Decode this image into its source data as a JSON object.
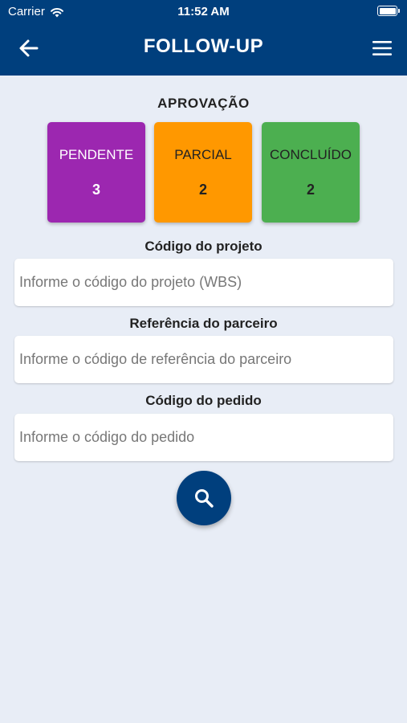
{
  "status_bar": {
    "carrier": "Carrier",
    "time": "11:52 AM"
  },
  "header": {
    "title": "FOLLOW-UP",
    "back_icon": "arrow-left-icon",
    "menu_icon": "hamburger-menu-icon"
  },
  "approval": {
    "title": "APROVAÇÃO",
    "cards": [
      {
        "label": "PENDENTE",
        "count": "3",
        "color": "#9c27b0",
        "text_color": "#ffffff"
      },
      {
        "label": "PARCIAL",
        "count": "2",
        "color": "#ff9800",
        "text_color": "#222222"
      },
      {
        "label": "CONCLUÍDO",
        "count": "2",
        "color": "#4caf50",
        "text_color": "#222222"
      }
    ]
  },
  "form": {
    "project": {
      "label": "Código do projeto",
      "placeholder": "Informe o código do projeto (WBS)",
      "value": ""
    },
    "partner": {
      "label": "Referência do parceiro",
      "placeholder": "Informe o código de referência do parceiro",
      "value": ""
    },
    "order": {
      "label": "Código do pedido",
      "placeholder": "Informe o código do pedido",
      "value": ""
    }
  },
  "search_button": {
    "icon": "search-icon",
    "color": "#003f7d"
  },
  "colors": {
    "primary": "#003f7d",
    "background": "#e8edf6"
  }
}
